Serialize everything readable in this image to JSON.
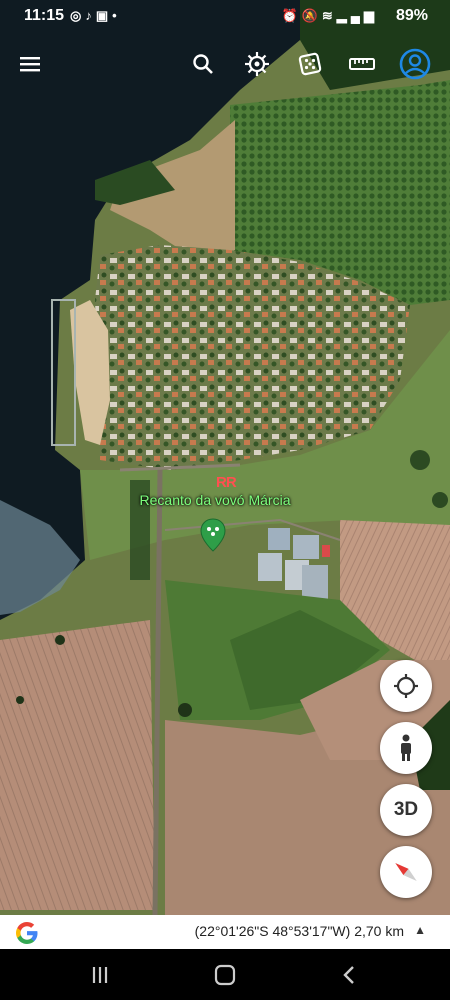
{
  "status_bar": {
    "time": "11:15",
    "left_icons": [
      "chrome-icon",
      "tiktok-icon",
      "sim-icon",
      "dot-icon"
    ],
    "battery": "89%"
  },
  "toolbar": {
    "icons": [
      "menu-icon",
      "search-icon",
      "voyager-icon",
      "dice-icon",
      "measure-icon",
      "account-icon"
    ]
  },
  "map": {
    "place_label": "Recanto da vovó Márcia",
    "place_code": "RR"
  },
  "controls": {
    "threed_label": "3D"
  },
  "bottom_bar": {
    "coordinates": "(22°01'26\"S 48°53'17\"W) 2,70 km"
  },
  "colors": {
    "account_accent": "#1e88e5",
    "label_green": "#7dff7d",
    "compass_red": "#e53935"
  }
}
